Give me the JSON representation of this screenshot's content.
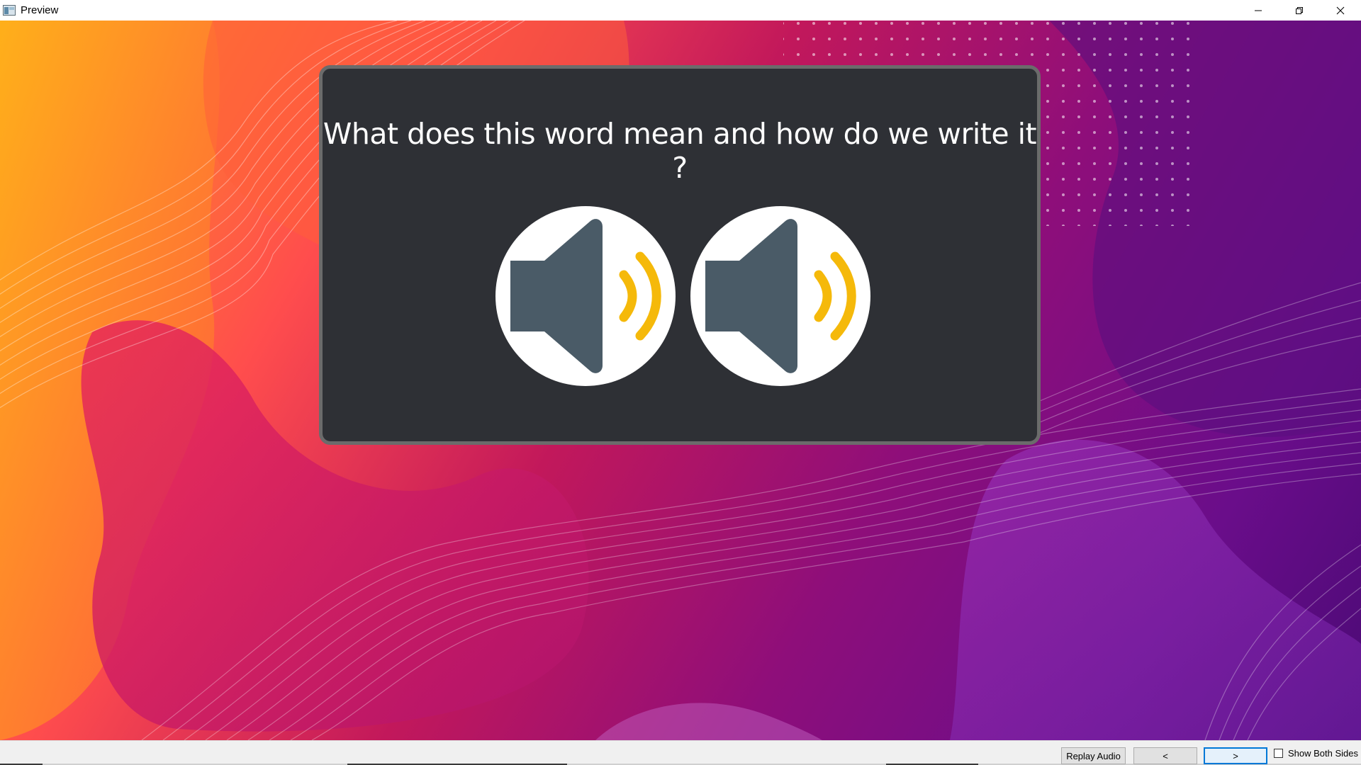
{
  "window": {
    "title": "Preview",
    "app_icon": "preview-app-icon",
    "controls": [
      "minimize-icon",
      "restore-icon",
      "close-icon"
    ]
  },
  "card": {
    "question": "What does this word mean and how do we write it ?",
    "audio_buttons": [
      {
        "icon": "speaker-icon"
      },
      {
        "icon": "speaker-icon"
      }
    ]
  },
  "toolbar": {
    "replay_label": "Replay Audio",
    "prev_label": "<",
    "next_label": ">",
    "show_both_sides_label": "Show Both Sides",
    "show_both_sides_checked": false
  },
  "colors": {
    "card_bg": "#2e3035",
    "card_border": "#6b6b6b",
    "speaker_body": "#4a5b67",
    "speaker_waves": "#f5b90a"
  }
}
